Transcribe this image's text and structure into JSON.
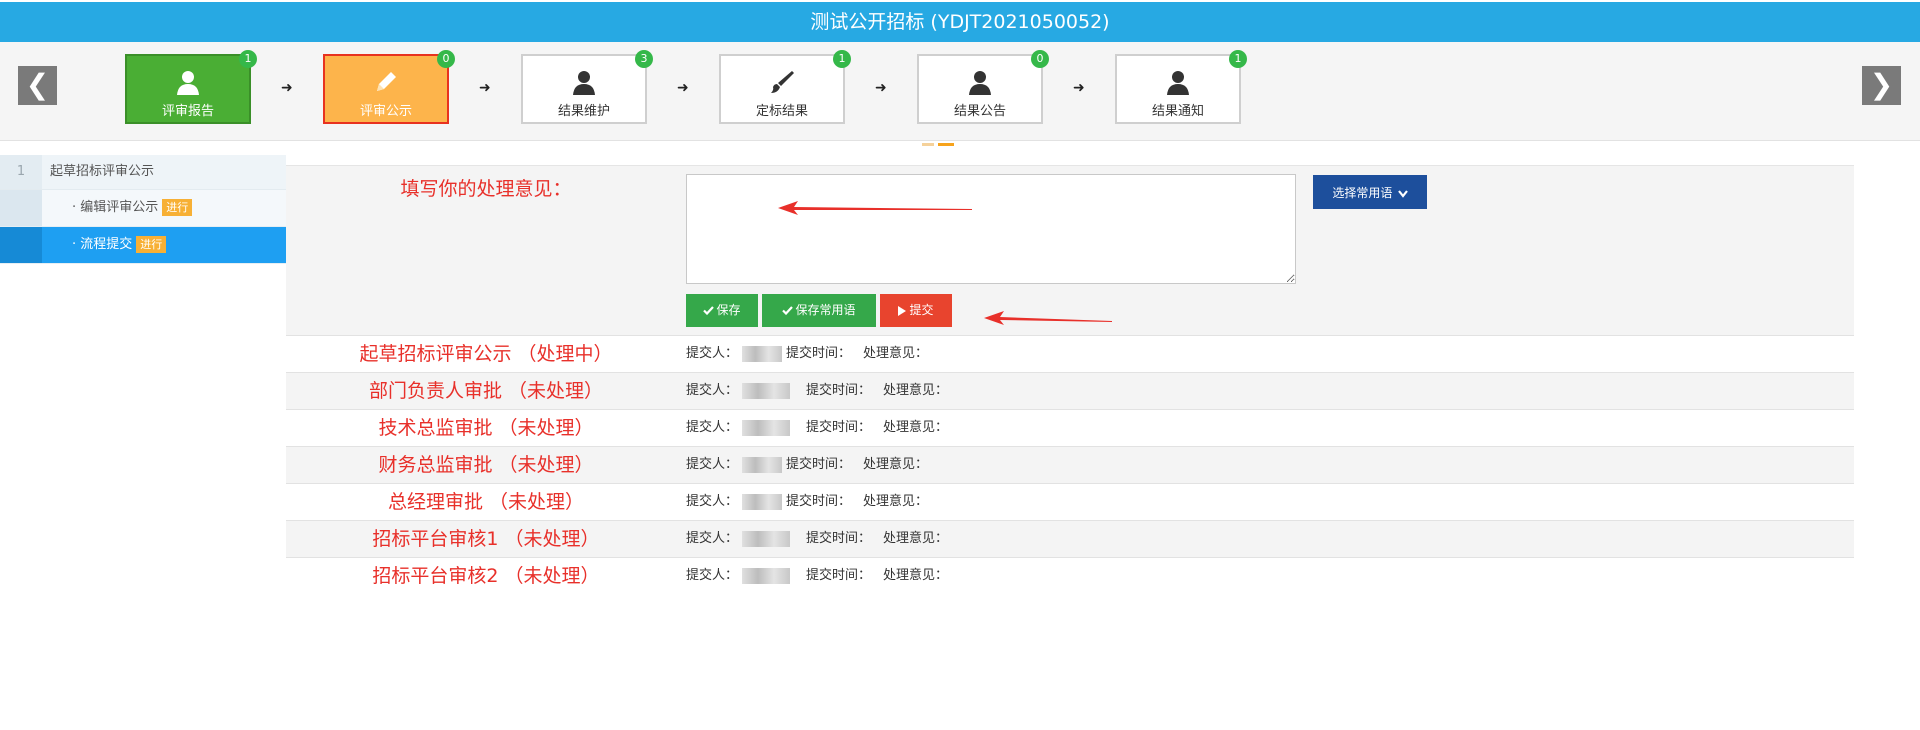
{
  "title": "测试公开招标 (YDJT2021050052)",
  "nav": {
    "prev": "❮",
    "next": "❯"
  },
  "steps": [
    {
      "label": "评审报告",
      "badge": "1",
      "state": "done",
      "icon": "user-icon"
    },
    {
      "label": "评审公示",
      "badge": "0",
      "state": "current",
      "icon": "pencil-icon"
    },
    {
      "label": "结果维护",
      "badge": "3",
      "state": "normal",
      "icon": "user-icon"
    },
    {
      "label": "定标结果",
      "badge": "1",
      "state": "normal",
      "icon": "brush-icon"
    },
    {
      "label": "结果公告",
      "badge": "0",
      "state": "normal",
      "icon": "user-icon"
    },
    {
      "label": "结果通知",
      "badge": "1",
      "state": "normal",
      "icon": "user-icon"
    }
  ],
  "step_arrow": "➜",
  "sidebar": {
    "group": {
      "num": "1",
      "label": "起草招标评审公示"
    },
    "items": [
      {
        "label": "· 编辑评审公示",
        "tag": "进行",
        "active": false
      },
      {
        "label": "· 流程提交",
        "tag": "进行",
        "active": true
      }
    ]
  },
  "opinion": {
    "label": "填写你的处理意见：",
    "value": "",
    "phrase_button": "选择常用语",
    "save": "保存",
    "save_phrase": "保存常用语",
    "submit": "提交"
  },
  "flow": {
    "submitter_label": "提交人：",
    "time_label": "提交时间：",
    "opinion_label": "处理意见：",
    "rows": [
      {
        "label": "起草招标评审公示 （处理中）"
      },
      {
        "label": "部门负责人审批 （未处理）"
      },
      {
        "label": "技术总监审批 （未处理）"
      },
      {
        "label": "财务总监审批 （未处理）"
      },
      {
        "label": "总经理审批 （未处理）"
      },
      {
        "label": "招标平台审核1 （未处理）"
      },
      {
        "label": "招标平台审核2 （未处理）"
      }
    ]
  },
  "colors": {
    "title_bar": "#27a9e3",
    "done": "#4aae34",
    "current": "#fdb44b",
    "label_red": "#e8302a",
    "primary": "#1d4f9c"
  }
}
